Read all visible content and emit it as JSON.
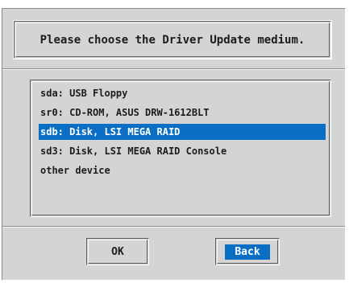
{
  "dialog": {
    "title": "Please choose the Driver Update medium."
  },
  "device_list": {
    "items": [
      {
        "label": "sda: USB Floppy",
        "selected": false
      },
      {
        "label": "sr0: CD-ROM, ASUS DRW-1612BLT",
        "selected": false
      },
      {
        "label": "sdb: Disk, LSI MEGA RAID",
        "selected": true
      },
      {
        "label": "sd3: Disk, LSI MEGA RAID Console",
        "selected": false
      },
      {
        "label": "other device",
        "selected": false
      }
    ]
  },
  "buttons": {
    "ok_label": "OK",
    "back_label": "Back",
    "focused": "back"
  },
  "colors": {
    "dialog_bg": "#d4d4d4",
    "selection": "#0a6fc4",
    "text": "#1c1c1c"
  }
}
